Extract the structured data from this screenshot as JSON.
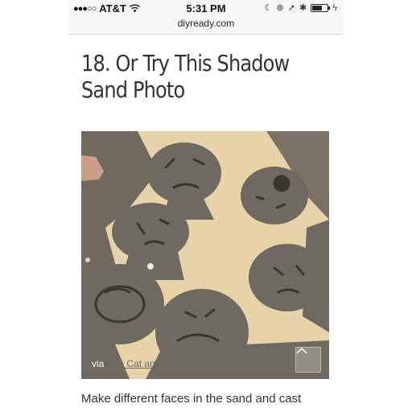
{
  "status_bar": {
    "signal": "●●●○○",
    "carrier": "AT&T",
    "time": "5:31 PM",
    "icons": [
      "wifi-icon",
      "moon-icon",
      "lock-rotation-icon",
      "location-arrow-icon",
      "bluetooth-icon",
      "battery-icon",
      "charging-bolt-icon"
    ]
  },
  "browser": {
    "url": "diyready.com"
  },
  "article": {
    "title": "18. Or Try This Shadow Sand Photo",
    "image": {
      "via_label": "via",
      "via_link": "The Cat and The Elephant"
    },
    "caption": "Make different faces in the sand and cast"
  },
  "colors": {
    "sand": "#e8d3a8",
    "shadow": "#6e6961",
    "title_text": "#333333"
  }
}
